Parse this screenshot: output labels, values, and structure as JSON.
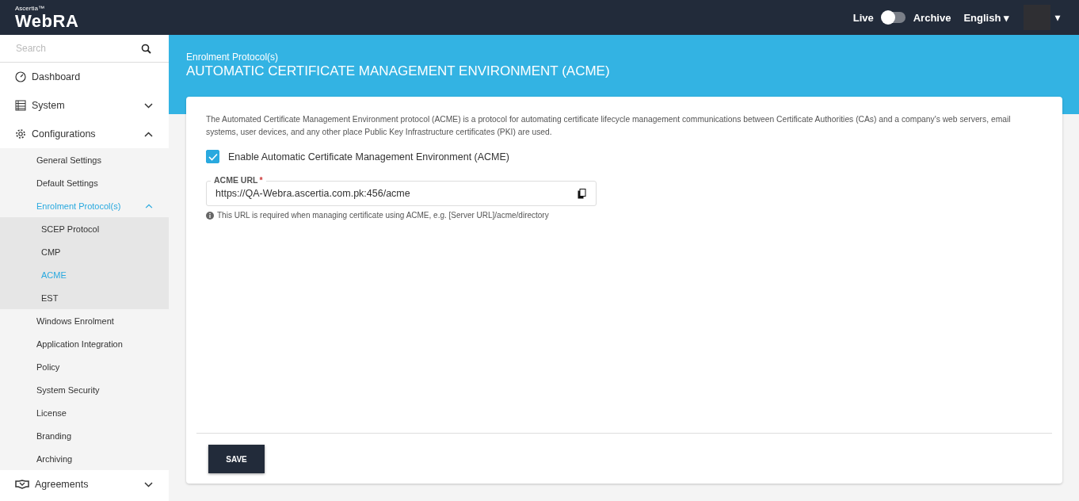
{
  "header": {
    "brand_small": "Ascertia™",
    "brand": "WebRA",
    "toggle": {
      "left_label": "Live",
      "right_label": "Archive",
      "on": false
    },
    "language": "English ▾",
    "user_caret": "▾"
  },
  "sidebar": {
    "search": {
      "placeholder": "Search"
    },
    "items": [
      {
        "label": "Dashboard"
      },
      {
        "label": "System",
        "expanded": false
      },
      {
        "label": "Configurations",
        "expanded": true,
        "children": [
          {
            "label": "General Settings",
            "selected": false
          },
          {
            "label": "Default Settings",
            "selected": false
          },
          {
            "label": "Enrolment Protocol(s)",
            "selected": true,
            "expanded": true,
            "children": [
              {
                "label": "SCEP Protocol",
                "selected": false
              },
              {
                "label": "CMP",
                "selected": false
              },
              {
                "label": "ACME",
                "selected": true
              },
              {
                "label": "EST",
                "selected": false
              }
            ]
          },
          {
            "label": "Windows Enrolment",
            "selected": false
          },
          {
            "label": "Application Integration",
            "selected": false
          },
          {
            "label": "Policy",
            "selected": false
          },
          {
            "label": "System Security",
            "selected": false
          },
          {
            "label": "License",
            "selected": false
          },
          {
            "label": "Branding",
            "selected": false
          },
          {
            "label": "Archiving",
            "selected": false
          }
        ]
      },
      {
        "label": "Agreements",
        "expanded": false
      }
    ]
  },
  "page": {
    "breadcrumb": "Enrolment Protocol(s)",
    "title": "AUTOMATIC CERTIFICATE MANAGEMENT ENVIRONMENT (ACME)"
  },
  "card": {
    "description": "The Automated Certificate Management Environment protocol (ACME) is a protocol for automating certificate lifecycle management communications between Certificate Authorities (CAs) and a company's web servers, email systems, user devices, and any other place Public Key Infrastructure certificates (PKI) are used.",
    "enable": {
      "label": "Enable Automatic Certificate Management Environment (ACME)",
      "checked": true
    },
    "url_field": {
      "label": "ACME URL",
      "required_mark": "*",
      "value": "https://QA-Webra.ascertia.com.pk:456/acme"
    },
    "hint": "This URL is required when managing certificate using ACME, e.g. [Server URL]/acme/directory",
    "save_button": "SAVE"
  }
}
